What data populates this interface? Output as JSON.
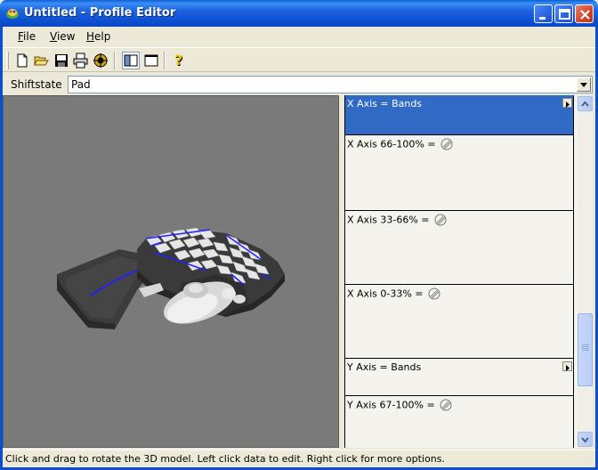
{
  "window": {
    "title": "Untitled - Profile Editor"
  },
  "menu": {
    "file": {
      "accel": "F",
      "rest": "ile"
    },
    "view": {
      "accel": "V",
      "rest": "iew"
    },
    "help": {
      "accel": "H",
      "rest": "elp"
    }
  },
  "toolbar": {
    "icons": [
      "new-file-icon",
      "open-folder-icon",
      "save-disk-icon",
      "print-icon",
      "target-icon",
      "split-view-icon",
      "single-view-icon",
      "help-question-icon"
    ],
    "pressed": "split-view-icon"
  },
  "shiftstate": {
    "label": "Shiftstate",
    "value": "Pad"
  },
  "properties": [
    {
      "label": "X Axis = Bands",
      "kind": "header",
      "selected": true
    },
    {
      "label": "X Axis 66-100% =",
      "kind": "assignment",
      "value_icon": "none-icon"
    },
    {
      "label": "X Axis 33-66% =",
      "kind": "assignment",
      "value_icon": "none-icon"
    },
    {
      "label": "X Axis 0-33% =",
      "kind": "assignment",
      "value_icon": "none-icon"
    },
    {
      "label": "Y Axis = Bands",
      "kind": "header",
      "selected": false
    },
    {
      "label": "Y Axis 67-100% =",
      "kind": "assignment",
      "value_icon": "none-icon"
    }
  ],
  "status": {
    "text": "Click and drag to rotate the 3D model. Left click data to edit. Right click for more options."
  },
  "colors": {
    "titlebar": "#0b4fd0",
    "selection": "#316ac5",
    "viewport_bg": "#7a7a7a",
    "highlight_edge": "#2222ff"
  }
}
